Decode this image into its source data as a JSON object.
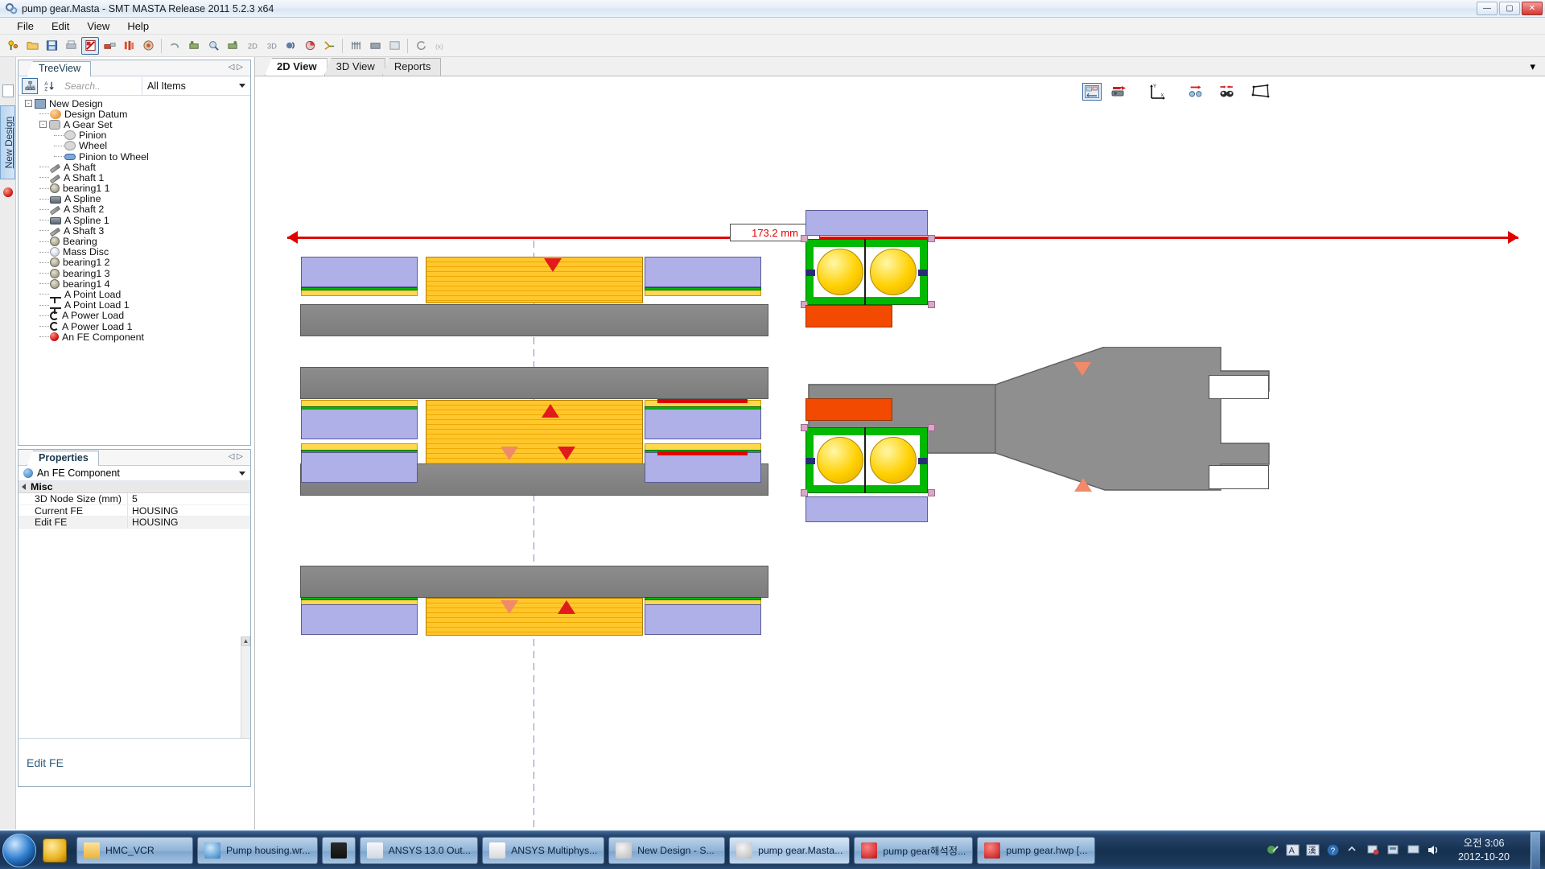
{
  "window": {
    "title": "pump gear.Masta - SMT MASTA Release 2011 5.2.3 x64",
    "icon": "masta-gear-icon",
    "minimize": "—",
    "maximize": "▢",
    "close": "✕"
  },
  "menu": {
    "items": [
      "File",
      "Edit",
      "View",
      "Help"
    ]
  },
  "toolbar": {
    "icons": [
      "new-design-icon",
      "open-folder-icon",
      "save-icon",
      "print-icon",
      "report-icon",
      "gear-set-icon",
      "shaft-assembly-icon",
      "bearing-icon",
      "undo-icon",
      "analysis-icon",
      "search-model-icon",
      "duty-cycle-icon",
      "2d-view-icon",
      "3d-view-icon",
      "results-icon",
      "chart-icon",
      "measure-icon",
      "fe-mesh-icon",
      "fe-component-icon",
      "tools-icon",
      "refresh-icon",
      "cancel-icon"
    ]
  },
  "left_rail": {
    "document_icon": "new-document-icon",
    "tab_label": "New Design",
    "fe_icon": "fe-component-icon"
  },
  "treeview": {
    "tab_label": "TreeView",
    "nav_prev": "◁",
    "nav_next": "▷",
    "hierarchy_button": "hierarchy-icon",
    "sort_button": "sort-az-icon",
    "search_placeholder": "Search..",
    "filter_value": "All Items",
    "items": [
      {
        "label": "New Design",
        "depth": 0,
        "icon": "design-icon",
        "expander": "-"
      },
      {
        "label": "Design Datum",
        "depth": 1,
        "icon": "datum-icon",
        "expander": ""
      },
      {
        "label": "A Gear Set",
        "depth": 1,
        "icon": "gear-set-icon",
        "expander": "-"
      },
      {
        "label": "Pinion",
        "depth": 2,
        "icon": "gear-icon",
        "expander": ""
      },
      {
        "label": "Wheel",
        "depth": 2,
        "icon": "gear-icon",
        "expander": ""
      },
      {
        "label": "Pinion to Wheel",
        "depth": 2,
        "icon": "mesh-link-icon",
        "expander": ""
      },
      {
        "label": "A Shaft",
        "depth": 1,
        "icon": "shaft-icon",
        "expander": ""
      },
      {
        "label": "A Shaft 1",
        "depth": 1,
        "icon": "shaft-icon",
        "expander": ""
      },
      {
        "label": "bearing1 1",
        "depth": 1,
        "icon": "bearing-icon",
        "expander": ""
      },
      {
        "label": "A Spline",
        "depth": 1,
        "icon": "spline-icon",
        "expander": ""
      },
      {
        "label": "A Shaft 2",
        "depth": 1,
        "icon": "shaft-icon",
        "expander": ""
      },
      {
        "label": "A Spline 1",
        "depth": 1,
        "icon": "spline-icon",
        "expander": ""
      },
      {
        "label": "A Shaft 3",
        "depth": 1,
        "icon": "shaft-icon",
        "expander": ""
      },
      {
        "label": "Bearing",
        "depth": 1,
        "icon": "bearing-icon",
        "expander": ""
      },
      {
        "label": "Mass Disc",
        "depth": 1,
        "icon": "mass-disc-icon",
        "expander": ""
      },
      {
        "label": "bearing1 2",
        "depth": 1,
        "icon": "bearing-icon",
        "expander": ""
      },
      {
        "label": "bearing1 3",
        "depth": 1,
        "icon": "bearing-icon",
        "expander": ""
      },
      {
        "label": "bearing1 4",
        "depth": 1,
        "icon": "bearing-icon",
        "expander": ""
      },
      {
        "label": "A Point Load",
        "depth": 1,
        "icon": "point-load-icon",
        "expander": ""
      },
      {
        "label": "A Point Load 1",
        "depth": 1,
        "icon": "point-load-icon",
        "expander": ""
      },
      {
        "label": "A Power Load",
        "depth": 1,
        "icon": "power-load-icon",
        "expander": ""
      },
      {
        "label": "A Power Load 1",
        "depth": 1,
        "icon": "power-load-icon",
        "expander": ""
      },
      {
        "label": "An FE Component",
        "depth": 1,
        "icon": "fe-component-icon",
        "expander": ""
      }
    ]
  },
  "properties": {
    "tab_label": "Properties",
    "nav_prev": "◁",
    "nav_next": "▷",
    "selected_object": "An FE Component",
    "group_label": "Misc",
    "rows": [
      {
        "key": "3D Node Size (mm)",
        "value": "5"
      },
      {
        "key": "Current FE",
        "value": "HOUSING"
      },
      {
        "key": "Edit FE",
        "value": "HOUSING"
      }
    ],
    "footer_label": "Edit FE"
  },
  "mainview": {
    "tabs": [
      {
        "label": "2D View",
        "active": true
      },
      {
        "label": "3D View",
        "active": false
      },
      {
        "label": "Reports",
        "active": false
      }
    ],
    "collapse_caret": "▾",
    "view_tools": [
      "fit-to-window-icon",
      "section-view-icon",
      "axis-triad-icon",
      "rotate-view-icon",
      "zoom-in-out-icon",
      "perspective-icon"
    ],
    "dimension_label": "173.2 mm",
    "dimension_color": "#e00000",
    "arrow_left": "left-dimension-arrow",
    "arrow_right": "right-dimension-arrow"
  },
  "taskbar": {
    "start_label": "start-orb",
    "pinned": [
      "messenger-icon"
    ],
    "tasks": [
      {
        "label": "HMC_VCR",
        "icon": "folder-icon",
        "active": false
      },
      {
        "label": "Pump housing.wr...",
        "icon": "browser-icon",
        "active": false
      },
      {
        "label": "",
        "icon": "keyboard-icon",
        "active": false
      },
      {
        "label": "ANSYS 13.0 Out...",
        "icon": "ansys-out-icon",
        "active": false
      },
      {
        "label": "ANSYS Multiphys...",
        "icon": "ansys-icon",
        "active": false
      },
      {
        "label": "New Design - S...",
        "icon": "masta-icon",
        "active": false
      },
      {
        "label": "pump gear.Masta...",
        "icon": "masta-icon",
        "active": true
      },
      {
        "label": "pump gear해석정...",
        "icon": "hwp-icon",
        "active": false
      },
      {
        "label": "pump gear.hwp [...",
        "icon": "hwp-icon",
        "active": false
      }
    ],
    "tray_icons": [
      "ime-pen-icon",
      "ime-a-icon",
      "ime-hanja-icon",
      "help-icon",
      "network-icon",
      "show-hidden-icon",
      "security-icon",
      "display-icon",
      "volume-icon"
    ],
    "clock_time": "오전 3:06",
    "clock_date": "2012-10-20"
  }
}
